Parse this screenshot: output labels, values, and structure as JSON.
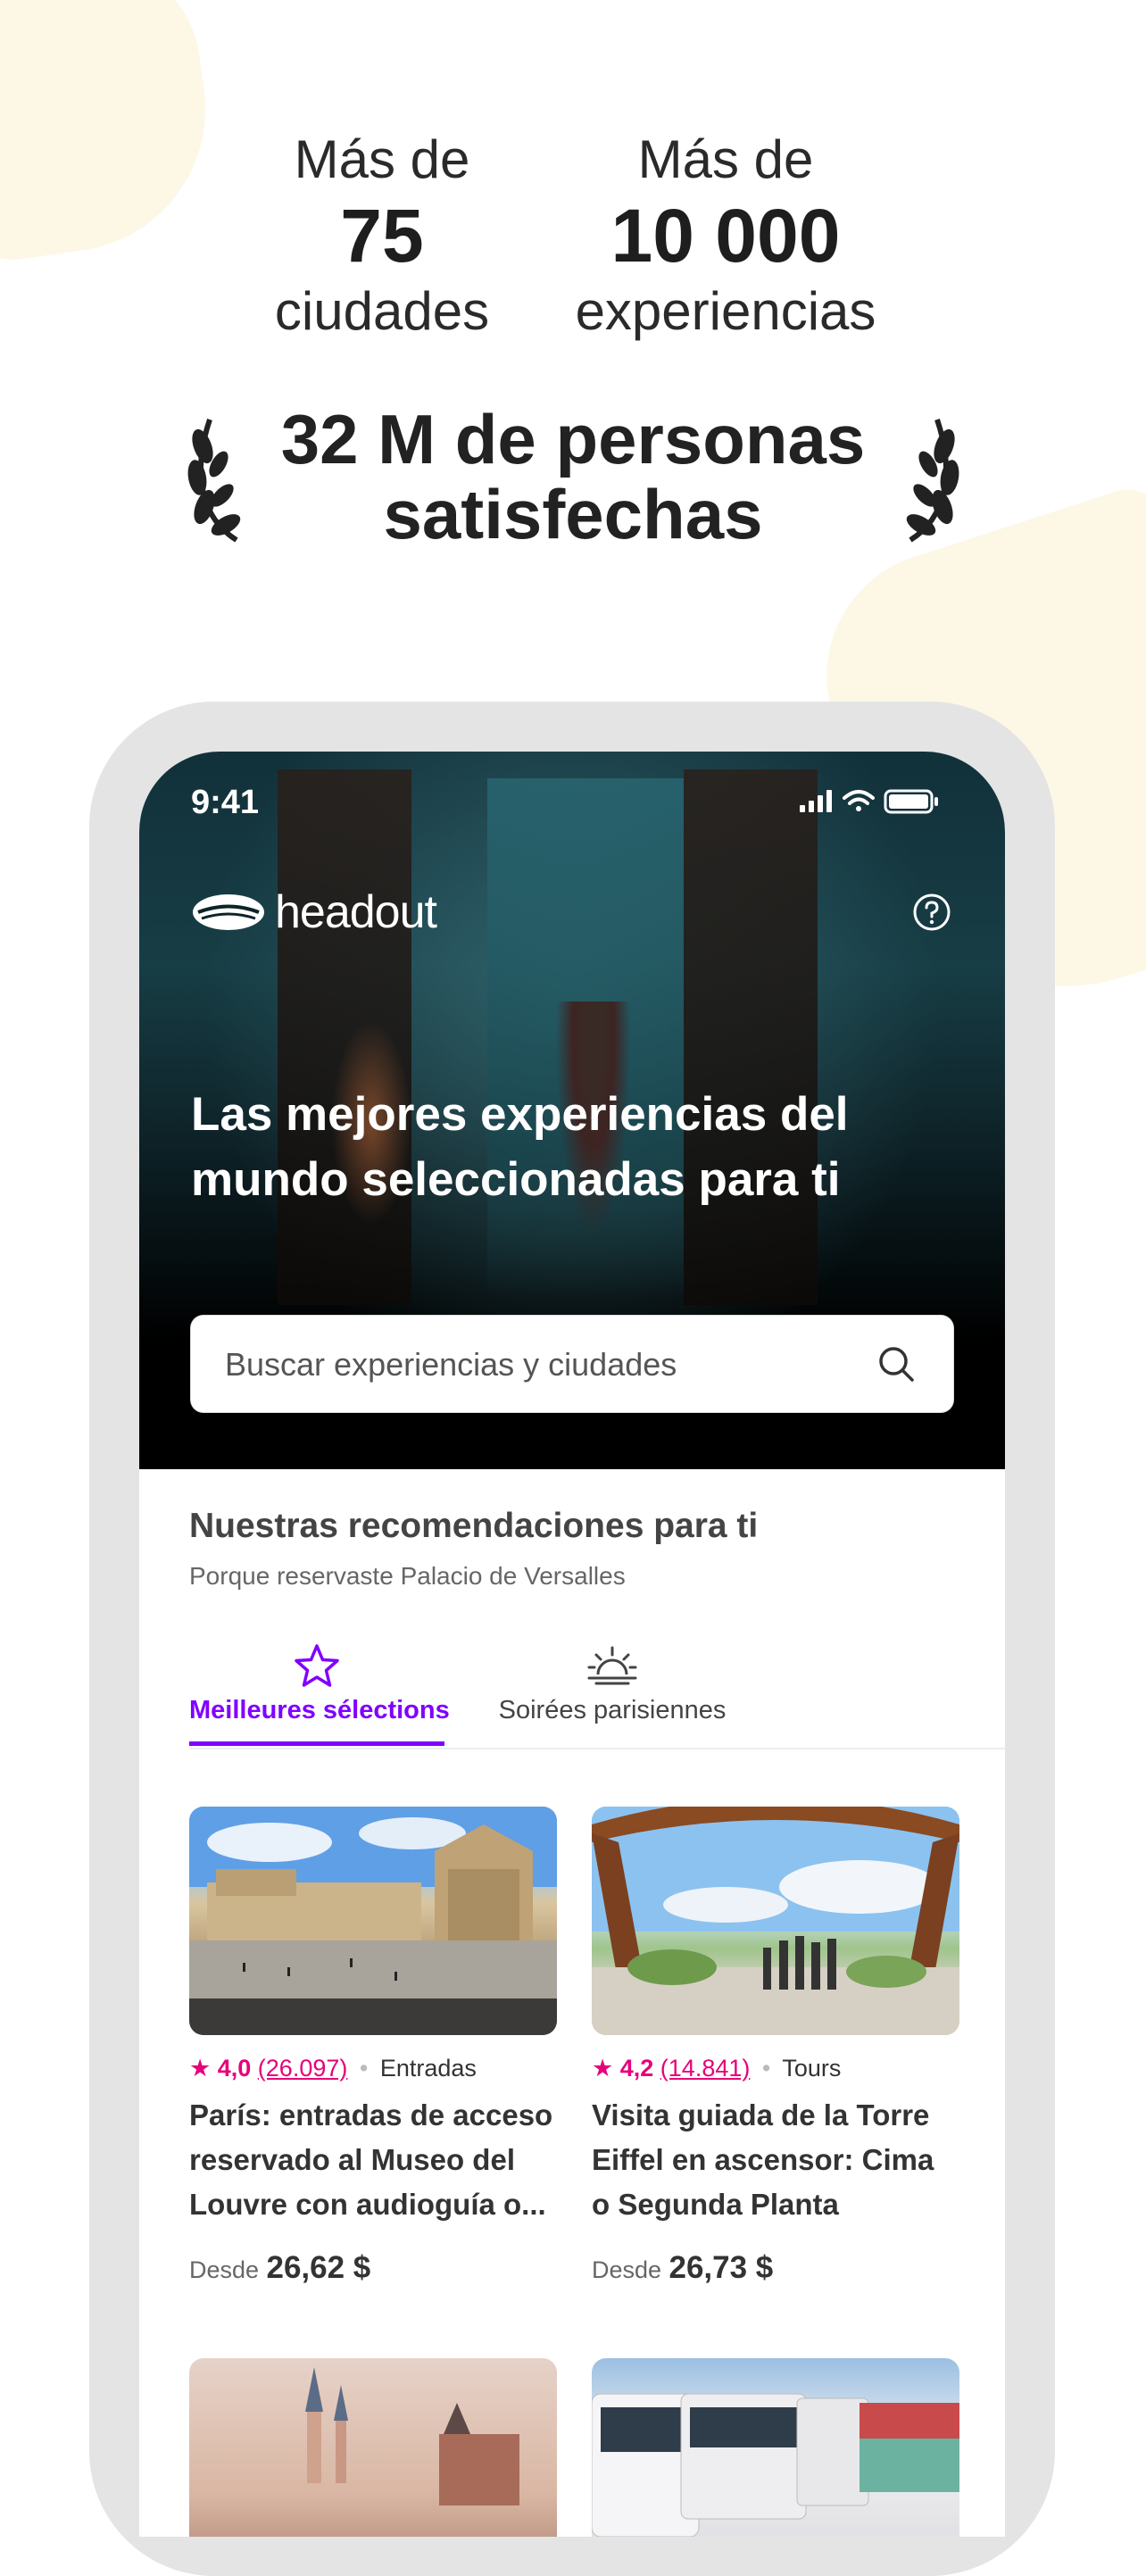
{
  "stats": {
    "cities": {
      "prefix": "Más de",
      "number": "75",
      "suffix": "ciudades"
    },
    "experiences": {
      "prefix": "Más de",
      "number": "10 000",
      "suffix": "experiencias"
    },
    "headline_line1": "32 M de personas",
    "headline_line2": "satisfechas"
  },
  "phone": {
    "status_time": "9:41",
    "logo_text": "headout",
    "hero_title": "Las mejores experiencias del mundo seleccionadas para ti",
    "search_placeholder": "Buscar experiencias y ciudades",
    "recommendations": {
      "title": "Nuestras recomendaciones para ti",
      "subtitle": "Porque reservaste Palacio de Versalles"
    },
    "tabs": [
      {
        "label": "Meilleures sélections",
        "icon": "star-icon",
        "active": true
      },
      {
        "label": "Soirées parisiennes",
        "icon": "sunset-icon",
        "active": false
      }
    ],
    "cards": [
      {
        "rating": "4,0",
        "reviews": "(26.097)",
        "category": "Entradas",
        "title": "París: entradas de acceso reservado al Museo del Louvre con audioguía o...",
        "price_prefix": "Desde",
        "price": "26,62 $"
      },
      {
        "rating": "4,2",
        "reviews": "(14.841)",
        "category": "Tours",
        "title": "Visita guiada de la Torre Eiffel en ascensor: Cima o Segunda Planta",
        "price_prefix": "Desde",
        "price": "26,73 $"
      }
    ]
  },
  "colors": {
    "accent": "#8000ff",
    "rating": "#e6007a",
    "hero_bg": "#000000"
  }
}
